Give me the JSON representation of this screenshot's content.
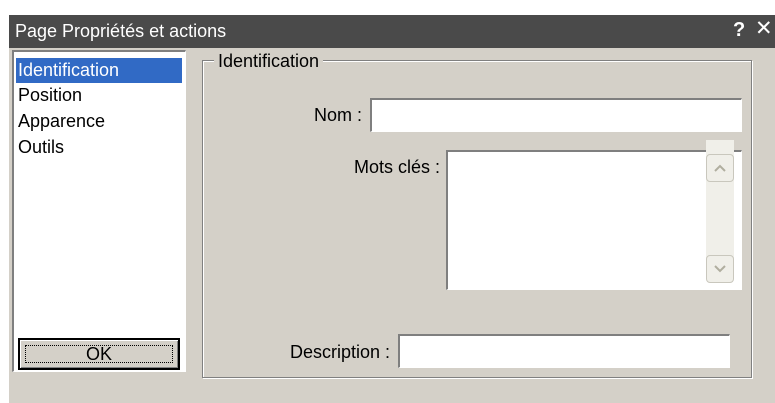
{
  "window": {
    "title": "Page  Propriétés et actions",
    "help_label": "?",
    "close_label": "✕"
  },
  "sidebar": {
    "items": [
      {
        "label": "Identification",
        "selected": true
      },
      {
        "label": "Position",
        "selected": false
      },
      {
        "label": "Apparence",
        "selected": false
      },
      {
        "label": "Outils",
        "selected": false
      }
    ],
    "ok_label": "OK"
  },
  "identification": {
    "group_title": "Identification",
    "name_label": "Nom :",
    "name_value": "",
    "keywords_label": "Mots clés :",
    "keywords_value": "",
    "description_label": "Description :",
    "description_value": ""
  },
  "icons": {
    "scroll_up": "chevron-up-icon",
    "scroll_down": "chevron-down-icon"
  },
  "colors": {
    "titlebar": "#4a4a4a",
    "selection": "#316ac5",
    "dialog_bg": "#d4d0c8"
  }
}
